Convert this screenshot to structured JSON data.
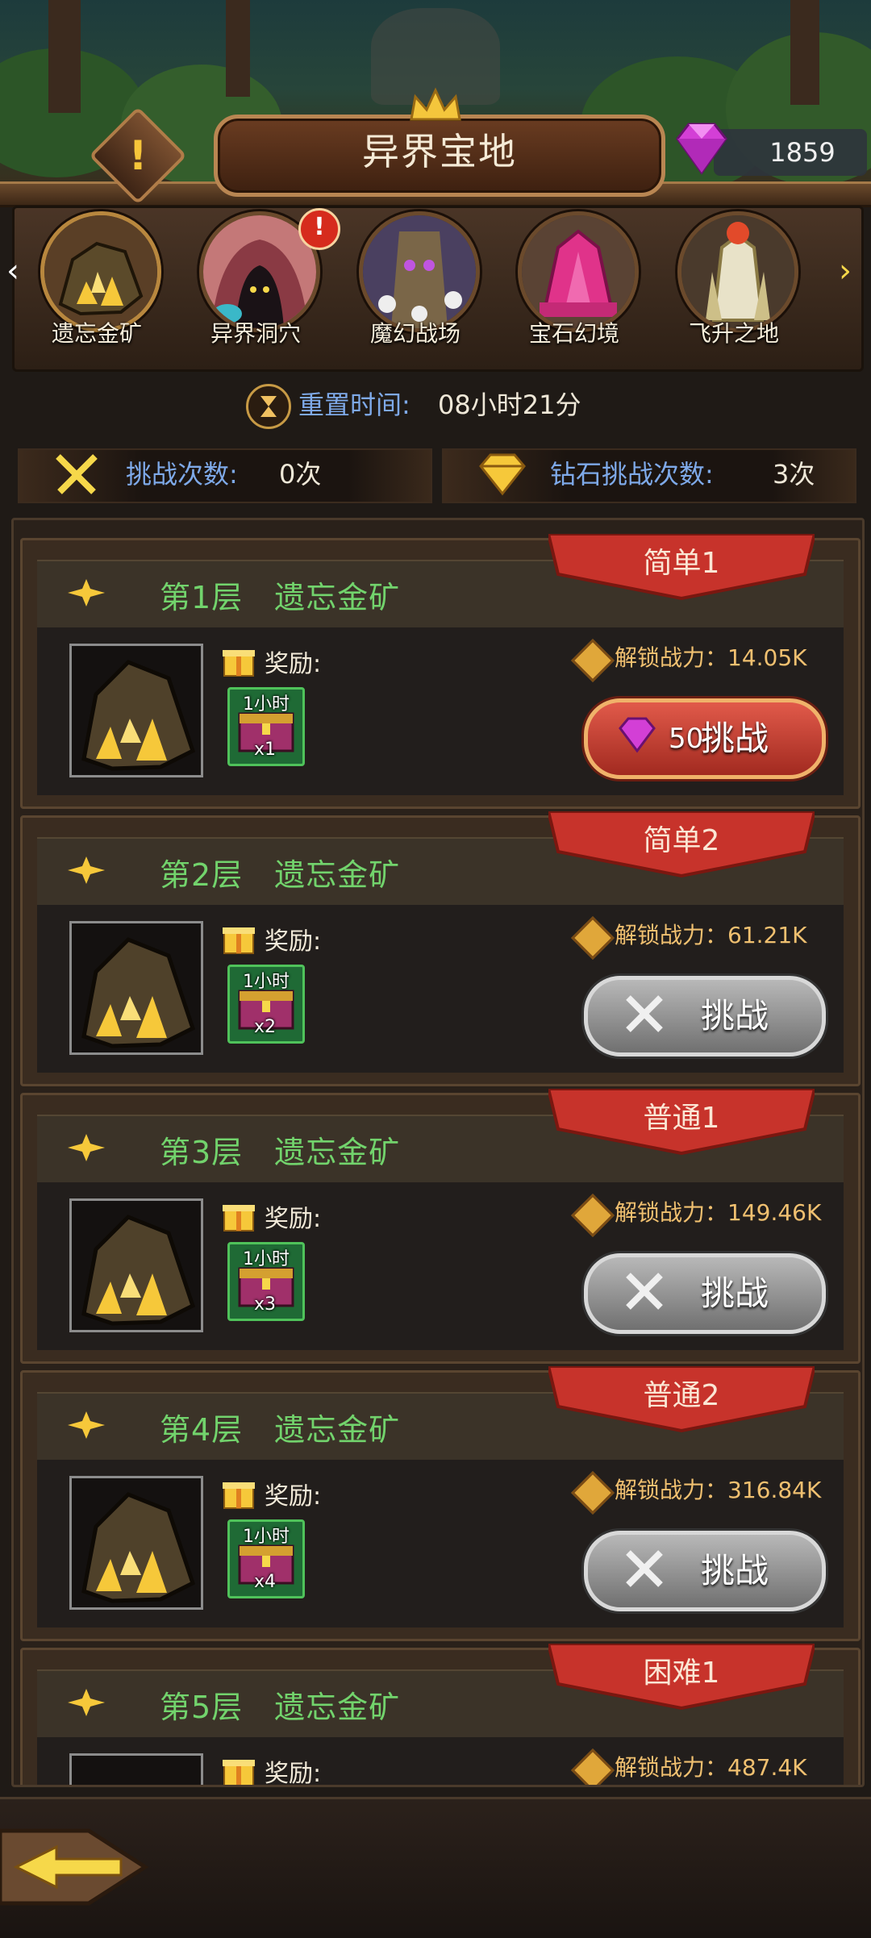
{
  "header": {
    "title": "异界宝地",
    "gem_count": "1859",
    "warn_glyph": "!"
  },
  "categories": {
    "badge": "!",
    "items": [
      {
        "label": "遗忘金矿",
        "icon": "gold-ore-icon",
        "selected": true
      },
      {
        "label": "异界洞穴",
        "icon": "cave-icon"
      },
      {
        "label": "魔幻战场",
        "icon": "battlefield-icon"
      },
      {
        "label": "宝石幻境",
        "icon": "gem-realm-icon"
      },
      {
        "label": "飞升之地",
        "icon": "ascension-icon"
      }
    ],
    "arrow_left": "‹",
    "arrow_right": "›"
  },
  "reset": {
    "label": "重置时间:",
    "value": "08小时21分"
  },
  "counters": {
    "challenge_label": "挑战次数:",
    "challenge_value": "0次",
    "diamond_label": "钻石挑战次数:",
    "diamond_value": "3次"
  },
  "floors": [
    {
      "name": "第1层　遗忘金矿",
      "difficulty": "简单1",
      "reward_label": "奖励:",
      "chest_time": "1小时",
      "chest_qty": "x1",
      "unlock": "解锁战力：14.05K",
      "button": "挑战",
      "cost": "50",
      "button_style": "gem"
    },
    {
      "name": "第2层　遗忘金矿",
      "difficulty": "简单2",
      "reward_label": "奖励:",
      "chest_time": "1小时",
      "chest_qty": "x2",
      "unlock": "解锁战力：61.21K",
      "button": "挑战",
      "button_style": "grey"
    },
    {
      "name": "第3层　遗忘金矿",
      "difficulty": "普通1",
      "reward_label": "奖励:",
      "chest_time": "1小时",
      "chest_qty": "x3",
      "unlock": "解锁战力：149.46K",
      "button": "挑战",
      "button_style": "grey"
    },
    {
      "name": "第4层　遗忘金矿",
      "difficulty": "普通2",
      "reward_label": "奖励:",
      "chest_time": "1小时",
      "chest_qty": "x4",
      "unlock": "解锁战力：316.84K",
      "button": "挑战",
      "button_style": "grey"
    },
    {
      "name": "第5层　遗忘金矿",
      "difficulty": "困难1",
      "reward_label": "奖励:",
      "unlock": "解锁战力：487.4K"
    }
  ],
  "colors": {
    "floor_name": "#72d36c",
    "label_blue": "#7ea9e8",
    "unlock": "#f0c070",
    "ribbon": "#c7332b"
  }
}
